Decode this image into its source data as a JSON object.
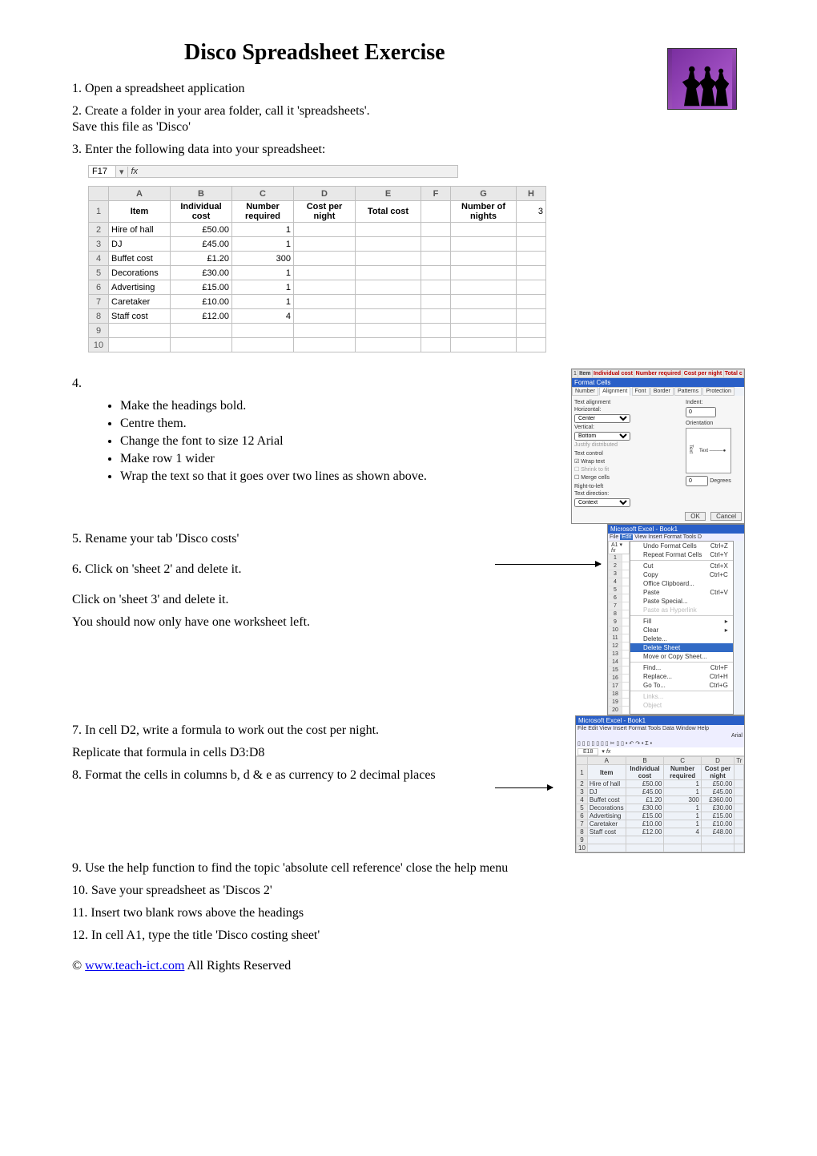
{
  "title": "Disco Spreadsheet Exercise",
  "logo_alt": "dancing silhouettes",
  "steps": {
    "s1": "1. Open a spreadsheet application",
    "s2a": "2. Create a folder in your area folder, call it 'spreadsheets'.",
    "s2b": "Save this file as 'Disco'",
    "s3": "3. Enter the following data into your spreadsheet:",
    "s4": "4.",
    "s4_items": [
      "Make the headings bold.",
      "Centre them.",
      "Change the font to size 12 Arial",
      "Make row 1 wider",
      "Wrap the text so that it goes over two lines as shown above."
    ],
    "s5": "5. Rename your tab 'Disco costs'",
    "s6": "6. Click on 'sheet 2' and delete it.",
    "s6b": "Click on 'sheet 3' and delete it.",
    "s6c": "You should now only have one worksheet left.",
    "s7": "7. In cell D2, write a formula to work out the cost per night.",
    "s7b": "Replicate that formula in cells D3:D8",
    "s8": "8. Format the cells in columns b, d & e as currency to 2 decimal places",
    "s9": "9.  Use the help function to find the topic 'absolute cell reference' close the help menu",
    "s10": "10. Save your spreadsheet as 'Discos 2'",
    "s11": "11. Insert two blank rows above the headings",
    "s12": "12. In cell A1, type the title 'Disco costing sheet'"
  },
  "footer": {
    "copyright": "©  ",
    "link_text": "www.teach-ict.com",
    "rights": "  All Rights Reserved"
  },
  "chart_data": {
    "type": "table",
    "name_box": "F17",
    "columns": [
      "A",
      "B",
      "C",
      "D",
      "E",
      "F",
      "G",
      "H"
    ],
    "headers": {
      "A": "Item",
      "B": "Individual cost",
      "C": "Number required",
      "D": "Cost per night",
      "E": "Total cost",
      "F": "",
      "G": "Number of nights",
      "H": "3"
    },
    "col_widths": {
      "A": 70,
      "B": 70,
      "C": 70,
      "D": 70,
      "E": 75,
      "F": 30,
      "G": 75,
      "H": 30
    },
    "rows": [
      {
        "n": 2,
        "A": "Hire of hall",
        "B": "£50.00",
        "C": "1"
      },
      {
        "n": 3,
        "A": "DJ",
        "B": "£45.00",
        "C": "1"
      },
      {
        "n": 4,
        "A": "Buffet cost",
        "B": "£1.20",
        "C": "300"
      },
      {
        "n": 5,
        "A": "Decorations",
        "B": "£30.00",
        "C": "1"
      },
      {
        "n": 6,
        "A": "Advertising",
        "B": "£15.00",
        "C": "1"
      },
      {
        "n": 7,
        "A": "Caretaker",
        "B": "£10.00",
        "C": "1"
      },
      {
        "n": 8,
        "A": "Staff cost",
        "B": "£12.00",
        "C": "4"
      },
      {
        "n": 9
      },
      {
        "n": 10
      }
    ]
  },
  "mini1": {
    "title": "Format Cells",
    "headers": [
      "Item",
      "Individual cost",
      "Number required",
      "Cost per night",
      "Total c"
    ],
    "tabs": [
      "Number",
      "Alignment",
      "Font",
      "Border",
      "Patterns",
      "Protection"
    ],
    "labels": {
      "text_align": "Text alignment",
      "horizontal": "Horizontal:",
      "horizontal_v": "Center",
      "vertical": "Vertical:",
      "vertical_v": "Bottom",
      "indent": "Indent:",
      "indent_v": "0",
      "orientation": "Orientation",
      "degrees": "Degrees",
      "degrees_v": "0",
      "text_control": "Text control",
      "wrap": "Wrap text",
      "shrink": "Shrink to fit",
      "merge": "Merge cells",
      "rtl": "Right-to-left",
      "text_dir": "Text direction:",
      "text_dir_v": "Context",
      "ok": "OK",
      "cancel": "Cancel"
    }
  },
  "mini2": {
    "title": "Microsoft Excel - Book1",
    "menus": [
      "File",
      "Edit",
      "View",
      "Insert",
      "Format",
      "Tools",
      "D"
    ],
    "name_box": "A1",
    "items": [
      {
        "l": "Undo Format Cells",
        "s": "Ctrl+Z"
      },
      {
        "l": "Repeat Format Cells",
        "s": "Ctrl+Y"
      },
      {
        "sep": true
      },
      {
        "l": "Cut",
        "s": "Ctrl+X"
      },
      {
        "l": "Copy",
        "s": "Ctrl+C"
      },
      {
        "l": "Office Clipboard...",
        "s": ""
      },
      {
        "l": "Paste",
        "s": "Ctrl+V"
      },
      {
        "l": "Paste Special...",
        "s": ""
      },
      {
        "l": "Paste as Hyperlink",
        "s": "",
        "dis": true
      },
      {
        "sep": true
      },
      {
        "l": "Fill",
        "s": "▸"
      },
      {
        "l": "Clear",
        "s": "▸"
      },
      {
        "l": "Delete...",
        "s": ""
      },
      {
        "l": "Delete Sheet",
        "s": "",
        "hl": true
      },
      {
        "l": "Move or Copy Sheet...",
        "s": ""
      },
      {
        "sep": true
      },
      {
        "l": "Find...",
        "s": "Ctrl+F"
      },
      {
        "l": "Replace...",
        "s": "Ctrl+H"
      },
      {
        "l": "Go To...",
        "s": "Ctrl+G"
      },
      {
        "sep": true
      },
      {
        "l": "Links...",
        "s": "",
        "dis": true
      },
      {
        "l": "Object",
        "s": "",
        "dis": true
      }
    ]
  },
  "mini3": {
    "title": "Microsoft Excel - Book1",
    "menus": [
      "File",
      "Edit",
      "View",
      "Insert",
      "Format",
      "Tools",
      "Data",
      "Window",
      "Help"
    ],
    "font": "Arial",
    "name_box": "E18",
    "columns": [
      "A",
      "B",
      "C",
      "D"
    ],
    "headers": {
      "A": "Item",
      "B": "Individual cost",
      "C": "Number required",
      "D": "Cost per night"
    },
    "extra": "Tr",
    "rows": [
      {
        "n": 2,
        "A": "Hire of hall",
        "B": "£50.00",
        "C": "1",
        "D": "£50.00"
      },
      {
        "n": 3,
        "A": "DJ",
        "B": "£45.00",
        "C": "1",
        "D": "£45.00"
      },
      {
        "n": 4,
        "A": "Buffet cost",
        "B": "£1.20",
        "C": "300",
        "D": "£360.00"
      },
      {
        "n": 5,
        "A": "Decorations",
        "B": "£30.00",
        "C": "1",
        "D": "£30.00"
      },
      {
        "n": 6,
        "A": "Advertising",
        "B": "£15.00",
        "C": "1",
        "D": "£15.00"
      },
      {
        "n": 7,
        "A": "Caretaker",
        "B": "£10.00",
        "C": "1",
        "D": "£10.00"
      },
      {
        "n": 8,
        "A": "Staff cost",
        "B": "£12.00",
        "C": "4",
        "D": "£48.00"
      },
      {
        "n": 9
      },
      {
        "n": 10
      }
    ]
  }
}
